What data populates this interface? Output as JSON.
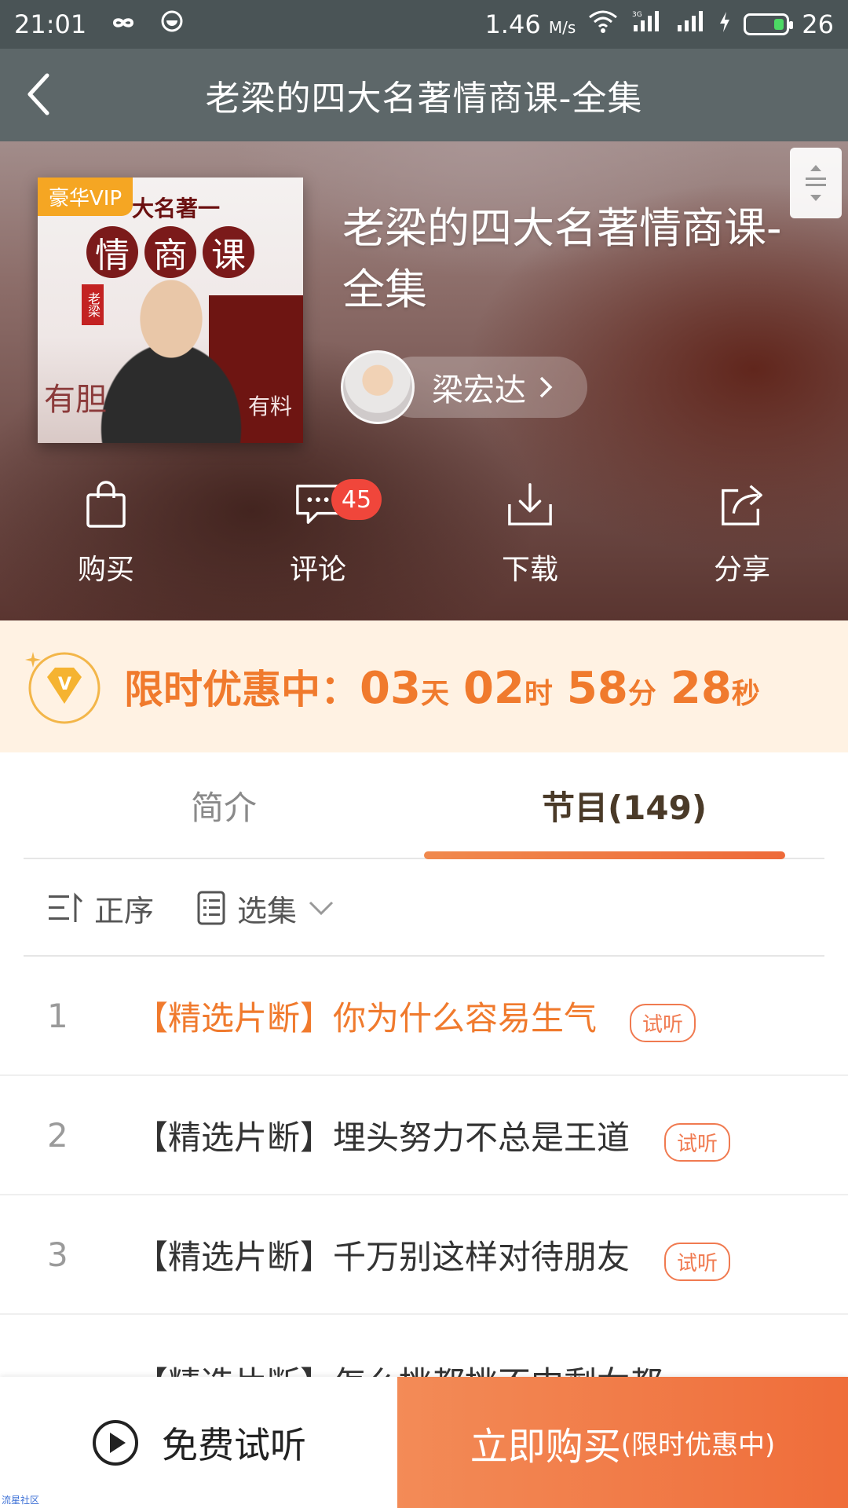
{
  "status_bar": {
    "time": "21:01",
    "speed_value": "1.46",
    "speed_unit": "M/s",
    "network": "3G",
    "battery_level": "26",
    "battery_fraction": 0.26
  },
  "nav": {
    "title": "老梁的四大名著情商课-全集"
  },
  "cover": {
    "vip_badge": "豪华VIP",
    "top_text": "大名著一",
    "title_chars": [
      "情",
      "商",
      "课"
    ],
    "stamp": "老梁",
    "word_left": "有胆",
    "word_right": "有料"
  },
  "book": {
    "title": "老梁的四大名著情商课-全集",
    "author": "梁宏达"
  },
  "actions": {
    "buy": "购买",
    "comment": "评论",
    "comment_count": "45",
    "download": "下载",
    "share": "分享"
  },
  "promo": {
    "label": "限时优惠中：",
    "days": "03",
    "days_unit": "天",
    "hours": "02",
    "hours_unit": "时",
    "minutes": "58",
    "minutes_unit": "分",
    "seconds": "28",
    "seconds_unit": "秒"
  },
  "tabs": {
    "intro": "简介",
    "episodes": "节目(149)"
  },
  "toolbar": {
    "order": "正序",
    "select": "选集"
  },
  "episodes": [
    {
      "num": "1",
      "title": "【精选片断】你为什么容易生气",
      "tag": "试听"
    },
    {
      "num": "2",
      "title": "【精选片断】埋头努力不总是王道",
      "tag": "试听"
    },
    {
      "num": "3",
      "title": "【精选片断】千万别这样对待朋友",
      "tag": "试听"
    },
    {
      "num": "",
      "title": "【精选片断】怎么挑都挑不中剩女都",
      "tag": ""
    }
  ],
  "bottom": {
    "free_listen": "免费试听",
    "buy_now": "立即购买",
    "buy_sub": "(限时优惠中)"
  },
  "watermark": "流星社区",
  "colors": {
    "accent": "#f07a2d",
    "badge": "#f0463b",
    "promo_bg": "#fff2e3"
  }
}
